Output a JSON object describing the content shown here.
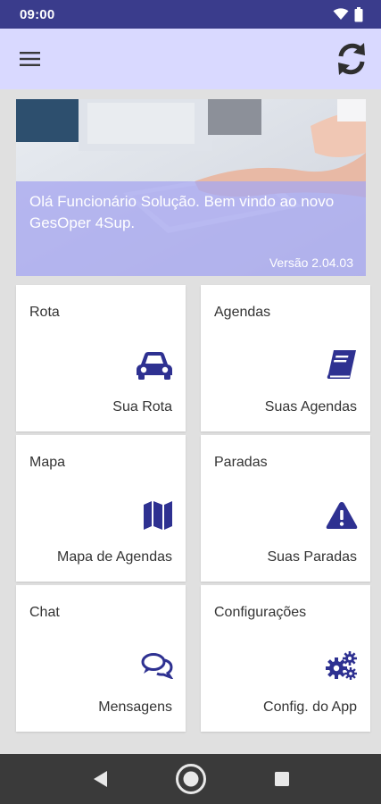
{
  "status_bar": {
    "time": "09:00",
    "icons": [
      "wifi-icon",
      "battery-icon"
    ]
  },
  "app_bar": {
    "menu_icon": "hamburger-menu-icon",
    "refresh_icon": "sync-icon"
  },
  "banner": {
    "greeting": "Olá Funcionário Solução. Bem vindo ao novo GesOper 4Sup.",
    "version": "Versão 2.04.03"
  },
  "cards": [
    {
      "title": "Rota",
      "subtitle": "Sua Rota",
      "icon": "car-icon"
    },
    {
      "title": "Agendas",
      "subtitle": "Suas Agendas",
      "icon": "book-icon"
    },
    {
      "title": "Mapa",
      "subtitle": "Mapa de Agendas",
      "icon": "map-icon"
    },
    {
      "title": "Paradas",
      "subtitle": "Suas Paradas",
      "icon": "warning-icon"
    },
    {
      "title": "Chat",
      "subtitle": "Mensagens",
      "icon": "chat-icon"
    },
    {
      "title": "Configurações",
      "subtitle": "Config. do App",
      "icon": "gears-icon"
    }
  ],
  "nav_bar": {
    "buttons": [
      "back-icon",
      "home-icon",
      "recents-icon"
    ]
  },
  "colors": {
    "status_bar": "#3a3c8c",
    "app_bar": "#d9d9ff",
    "accent_icon": "#2e3191",
    "banner_overlay": "#a8a8f0",
    "nav_bar": "#3a3a3a"
  }
}
